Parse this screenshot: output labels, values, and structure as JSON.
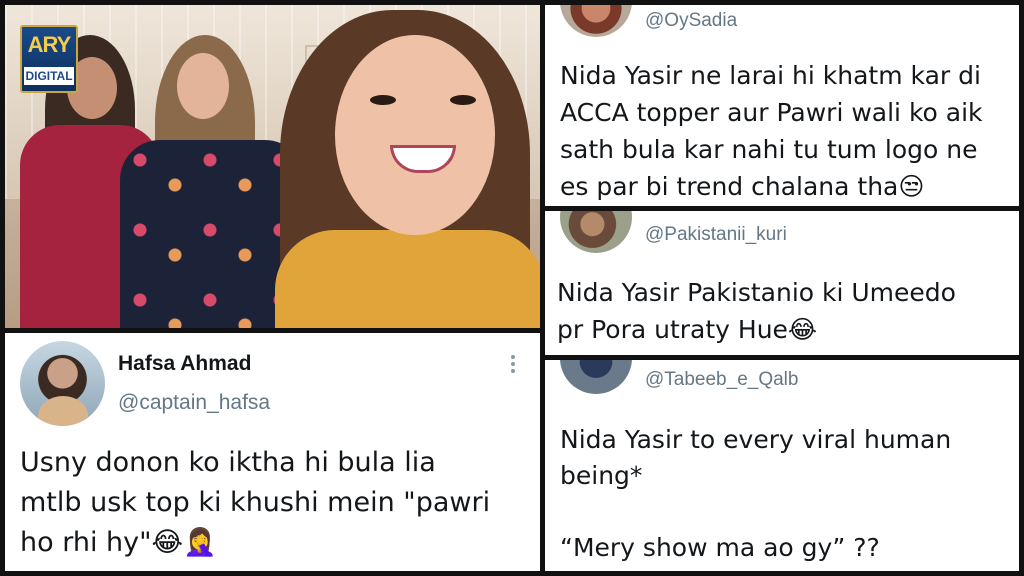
{
  "photo": {
    "logo_top": "ARY",
    "logo_bottom": "DIGITAL"
  },
  "tweets": [
    {
      "name": "Hafsa Ahmad",
      "handle": "@captain_hafsa",
      "text": "Usny donon ko iktha hi bula lia\nmtlb usk top ki khushi mein \"pawri\nho rhi hy\"😂🤦‍♀️"
    },
    {
      "handle": "@OySadia",
      "text": "Nida Yasir ne larai hi khatm kar di\nACCA topper aur Pawri wali ko aik\nsath bula kar nahi tu tum logo ne\nes par bi trend chalana tha😒"
    },
    {
      "handle": "@Pakistanii_kuri",
      "text": "Nida Yasir Pakistanio ki Umeedo\npr Pora utraty Hue😂"
    },
    {
      "handle": "@Tabeeb_e_Qalb",
      "text": "Nida Yasir to every viral human\nbeing*\n\n“Mery show ma ao gy” ??"
    }
  ],
  "colors": {
    "background": "#111111",
    "card": "#ffffff",
    "text": "#14171a",
    "handle": "#657786"
  }
}
